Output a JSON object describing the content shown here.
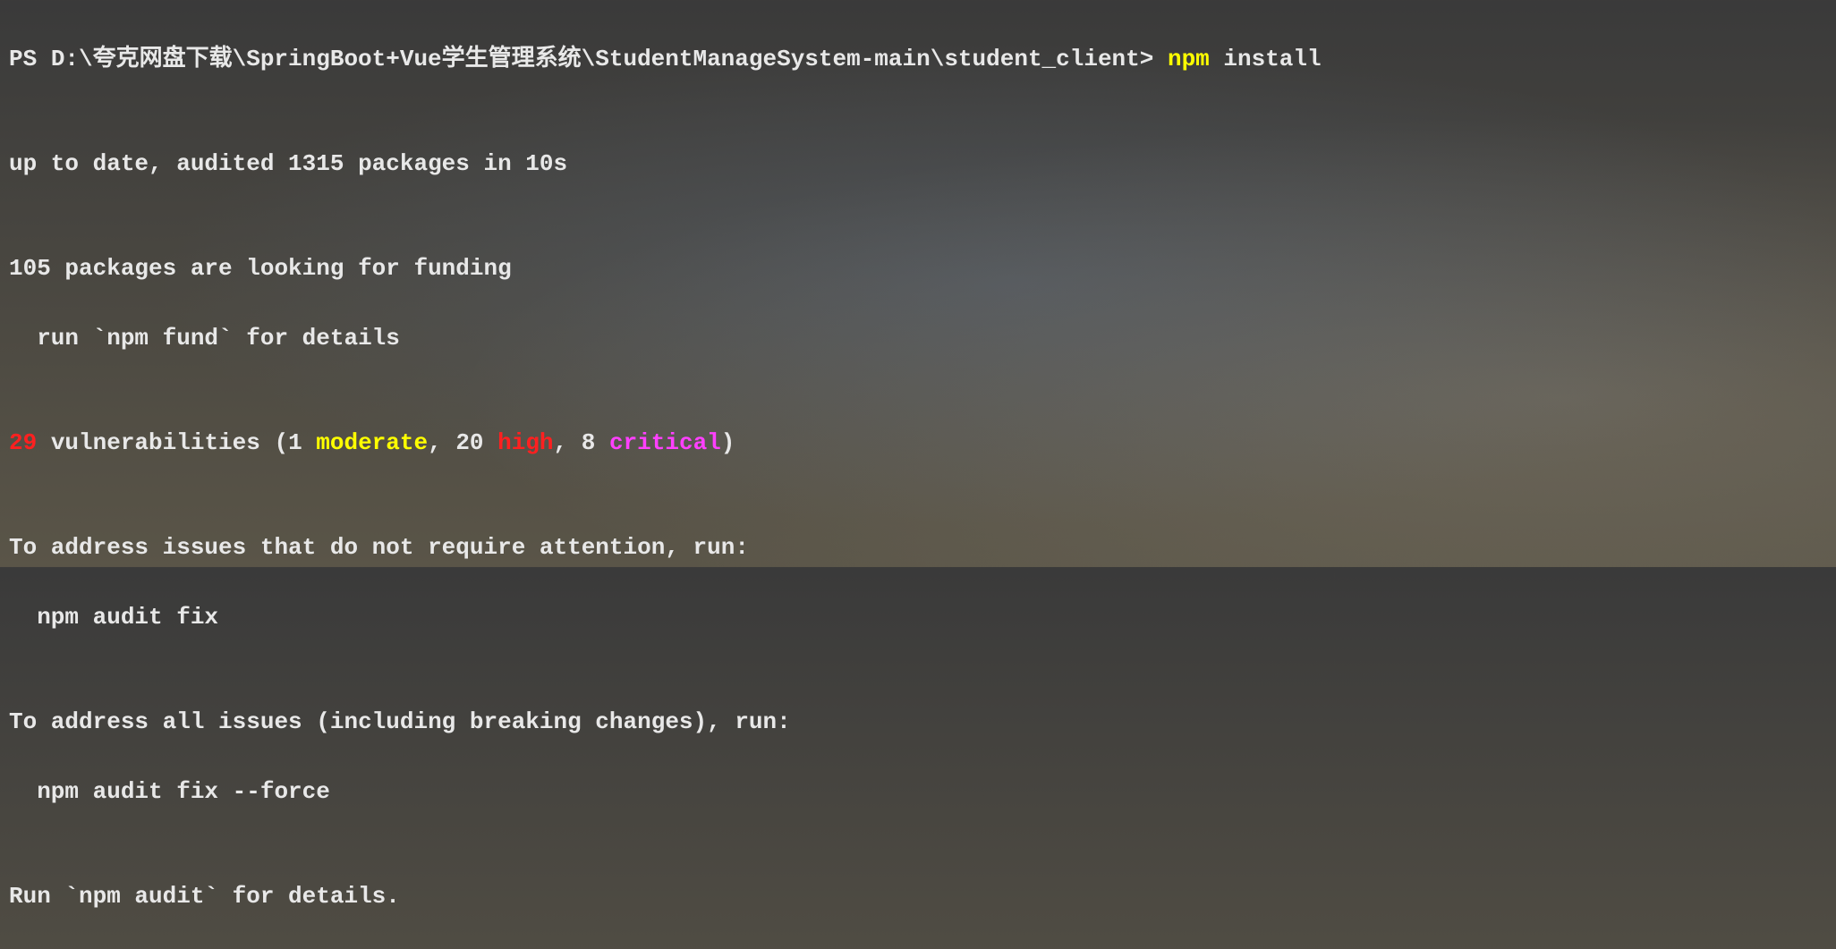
{
  "prompt": {
    "ps": "PS ",
    "path": "D:\\夸克网盘下载\\SpringBoot+Vue学生管理系统\\StudentManageSystem-main\\student_client> ",
    "command": "npm",
    "args": " install"
  },
  "output": {
    "blank1": "",
    "uptodate": "up to date, audited 1315 packages in 10s",
    "blank2": "",
    "funding1": "105 packages are looking for funding",
    "funding2": "  run `npm fund` for details",
    "blank3": "",
    "vuln": {
      "count": "29",
      "text1": " vulnerabilities (1 ",
      "moderate": "moderate",
      "text2": ", 20 ",
      "high": "high",
      "text3": ", 8 ",
      "critical": "critical",
      "text4": ")"
    },
    "blank4": "",
    "address1": "To address issues that do not require attention, run:",
    "address2": "  npm audit fix",
    "blank5": "",
    "address3": "To address all issues (including breaking changes), run:",
    "address4": "  npm audit fix --force",
    "blank6": "",
    "auditinfo": "Run `npm audit` for details."
  }
}
